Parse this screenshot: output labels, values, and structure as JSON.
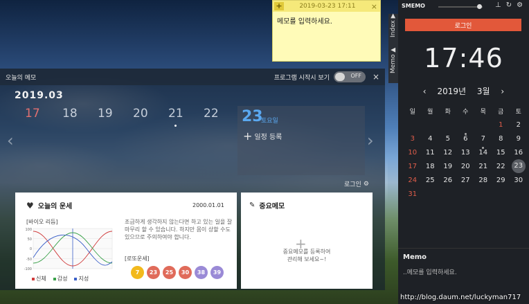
{
  "sticky": {
    "add_label": "+",
    "datetime": "2019-03-23 17:11",
    "close": "×",
    "placeholder": "메모를 입력하세요."
  },
  "panel": {
    "title": "오늘의 메모",
    "startup_label": "프로그램 시작시 보기",
    "toggle_state": "OFF",
    "close": "×",
    "year_month": "2019.03",
    "days": [
      "17",
      "18",
      "19",
      "20",
      "21",
      "22"
    ],
    "today_num": "23",
    "today_dow": "토요일",
    "add_schedule": "일정 등록",
    "login": "로그인"
  },
  "fortune": {
    "title": "오늘의 운세",
    "date": "2000.01.01",
    "bio_label": "[바이오 리듬]",
    "bio_ticks": [
      "100",
      "50",
      "0",
      "-50",
      "-100"
    ],
    "legend": [
      {
        "label": "신체",
        "color": "#d03b3b"
      },
      {
        "label": "감성",
        "color": "#3aa14a"
      },
      {
        "label": "지성",
        "color": "#3a5fc8"
      }
    ],
    "text": "조급하게 생각하지 않는다면 하고 있는 일을 잘 마무리 할 수 있습니다. 하지만 몸이 상할 수도 있으므로 주의하여야 합니다.",
    "lotto_label": "[로또운세]",
    "lotto": [
      {
        "n": "7",
        "color": "#f2b91c"
      },
      {
        "n": "23",
        "color": "#e06b5a"
      },
      {
        "n": "25",
        "color": "#e06b5a"
      },
      {
        "n": "30",
        "color": "#e06b5a"
      },
      {
        "n": "38",
        "color": "#9a8ad6"
      },
      {
        "n": "39",
        "color": "#9a8ad6"
      }
    ]
  },
  "memo_card": {
    "title": "중요메모",
    "line1": "중요메모를 등록하여",
    "line2": "관리해 보세요~!"
  },
  "sidebar": {
    "brand": "SMEMO",
    "login": "로그인",
    "clock": "17:46",
    "year": "2019년",
    "month": "3월",
    "weekdays": [
      "일",
      "월",
      "화",
      "수",
      "목",
      "금",
      "토"
    ],
    "weeks": [
      [
        "",
        "",
        "",
        "",
        "",
        "1",
        "2"
      ],
      [
        "3",
        "4",
        "5",
        "6",
        "7",
        "8",
        "9"
      ],
      [
        "10",
        "11",
        "12",
        "13",
        "14",
        "15",
        "16"
      ],
      [
        "17",
        "18",
        "19",
        "20",
        "21",
        "22",
        "23"
      ],
      [
        "24",
        "25",
        "26",
        "27",
        "28",
        "29",
        "30"
      ],
      [
        "31",
        "",
        "",
        "",
        "",
        "",
        ""
      ]
    ],
    "memo_title": "Memo",
    "memo_placeholder": "..메모를 입력하세요.",
    "tab_index": "Index ▶",
    "tab_memo": "Memo ▲"
  },
  "watermark": "http://blog.daum.net/luckyman717"
}
